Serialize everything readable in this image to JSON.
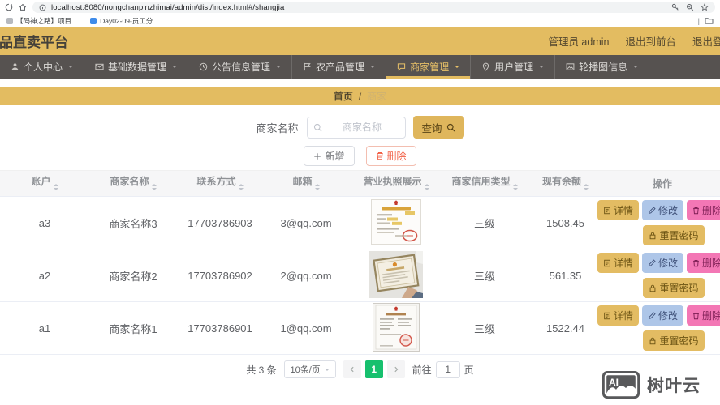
{
  "browser": {
    "url": "localhost:8080/nongchanpinzhimai/admin/dist/index.html#/shangjia",
    "bookmarks": [
      {
        "label": "【码神之路】项目..."
      },
      {
        "label": "Day02-09-员工分..."
      }
    ]
  },
  "header": {
    "title": "品直卖平台",
    "user": "管理员 admin",
    "logout_front": "退出到前台",
    "logout": "退出登录"
  },
  "nav": {
    "items": [
      {
        "label": "个人中心"
      },
      {
        "label": "基础数据管理"
      },
      {
        "label": "公告信息管理"
      },
      {
        "label": "农产品管理"
      },
      {
        "label": "商家管理"
      },
      {
        "label": "用户管理"
      },
      {
        "label": "轮播图信息"
      }
    ]
  },
  "breadcrumb": {
    "home": "首页",
    "separator": "/",
    "current": "商家"
  },
  "search": {
    "label": "商家名称",
    "placeholder": "商家名称",
    "query_label": "查询"
  },
  "toolbar": {
    "add_label": "新增",
    "delete_label": "删除"
  },
  "table": {
    "columns": [
      "账户",
      "商家名称",
      "联系方式",
      "邮箱",
      "营业执照展示",
      "商家信用类型",
      "现有余额",
      "操作"
    ],
    "rows": [
      {
        "account": "a3",
        "name": "商家名称3",
        "phone": "17703786903",
        "email": "3@qq.com",
        "credit": "三级",
        "balance": "1508.45"
      },
      {
        "account": "a2",
        "name": "商家名称2",
        "phone": "17703786902",
        "email": "2@qq.com",
        "credit": "三级",
        "balance": "561.35"
      },
      {
        "account": "a1",
        "name": "商家名称1",
        "phone": "17703786901",
        "email": "1@qq.com",
        "credit": "三级",
        "balance": "1522.44"
      }
    ],
    "actions": {
      "detail": "详情",
      "edit": "修改",
      "remove": "删除",
      "reset": "重置密码"
    }
  },
  "pagination": {
    "total": "共 3 条",
    "page_size": "10条/页",
    "current_page": "1",
    "goto_label": "前往",
    "goto_value": "1",
    "page_label": "页"
  },
  "watermark": {
    "logo_text": "AI",
    "brand": "树叶云"
  },
  "colors": {
    "accent_gold": "#e3bc61",
    "nav_dark": "#565250",
    "pager_green": "#17c06e",
    "btn_edit_blue": "#aec6e8",
    "btn_delete_pink": "#f377b5",
    "danger_red": "#f25e43"
  }
}
